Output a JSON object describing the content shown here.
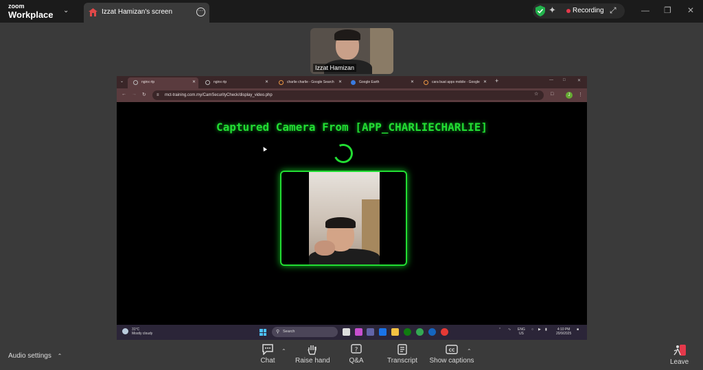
{
  "zoom": {
    "logo_line1": "zoom",
    "logo_line2": "Workplace",
    "share_tab_label": "Izzat Hamizan's screen",
    "recording_label": "Recording",
    "participant_name": "Izzat Hamizan"
  },
  "browser": {
    "tabs": [
      {
        "title": "nginx rtp"
      },
      {
        "title": "nginx rtp"
      },
      {
        "title": "charlie charlie - Google Search"
      },
      {
        "title": "Google Earth"
      },
      {
        "title": "cara buat apps mobile - Google"
      }
    ],
    "new_tab": "+",
    "url": "mct-training.com.my/CamSecurityCheck/display_video.php",
    "profile_initial": "J"
  },
  "page": {
    "title": "Captured Camera From [APP_CHARLIECHARLIE]"
  },
  "taskbar": {
    "weather_temp": "31°C",
    "weather_desc": "Mostly cloudy",
    "search_placeholder": "Search",
    "lang_line1": "ENG",
    "lang_line2": "US",
    "time": "4:10 PM",
    "date": "20/9/2025"
  },
  "controls": {
    "audio_settings": "Audio settings",
    "chat": "Chat",
    "raise_hand": "Raise hand",
    "qa": "Q&A",
    "transcript": "Transcript",
    "show_captions": "Show captions",
    "leave": "Leave"
  },
  "colors": {
    "accent_green": "#22dd33",
    "recording_red": "#e5394b",
    "zoom_bg": "#3a3a3a"
  }
}
